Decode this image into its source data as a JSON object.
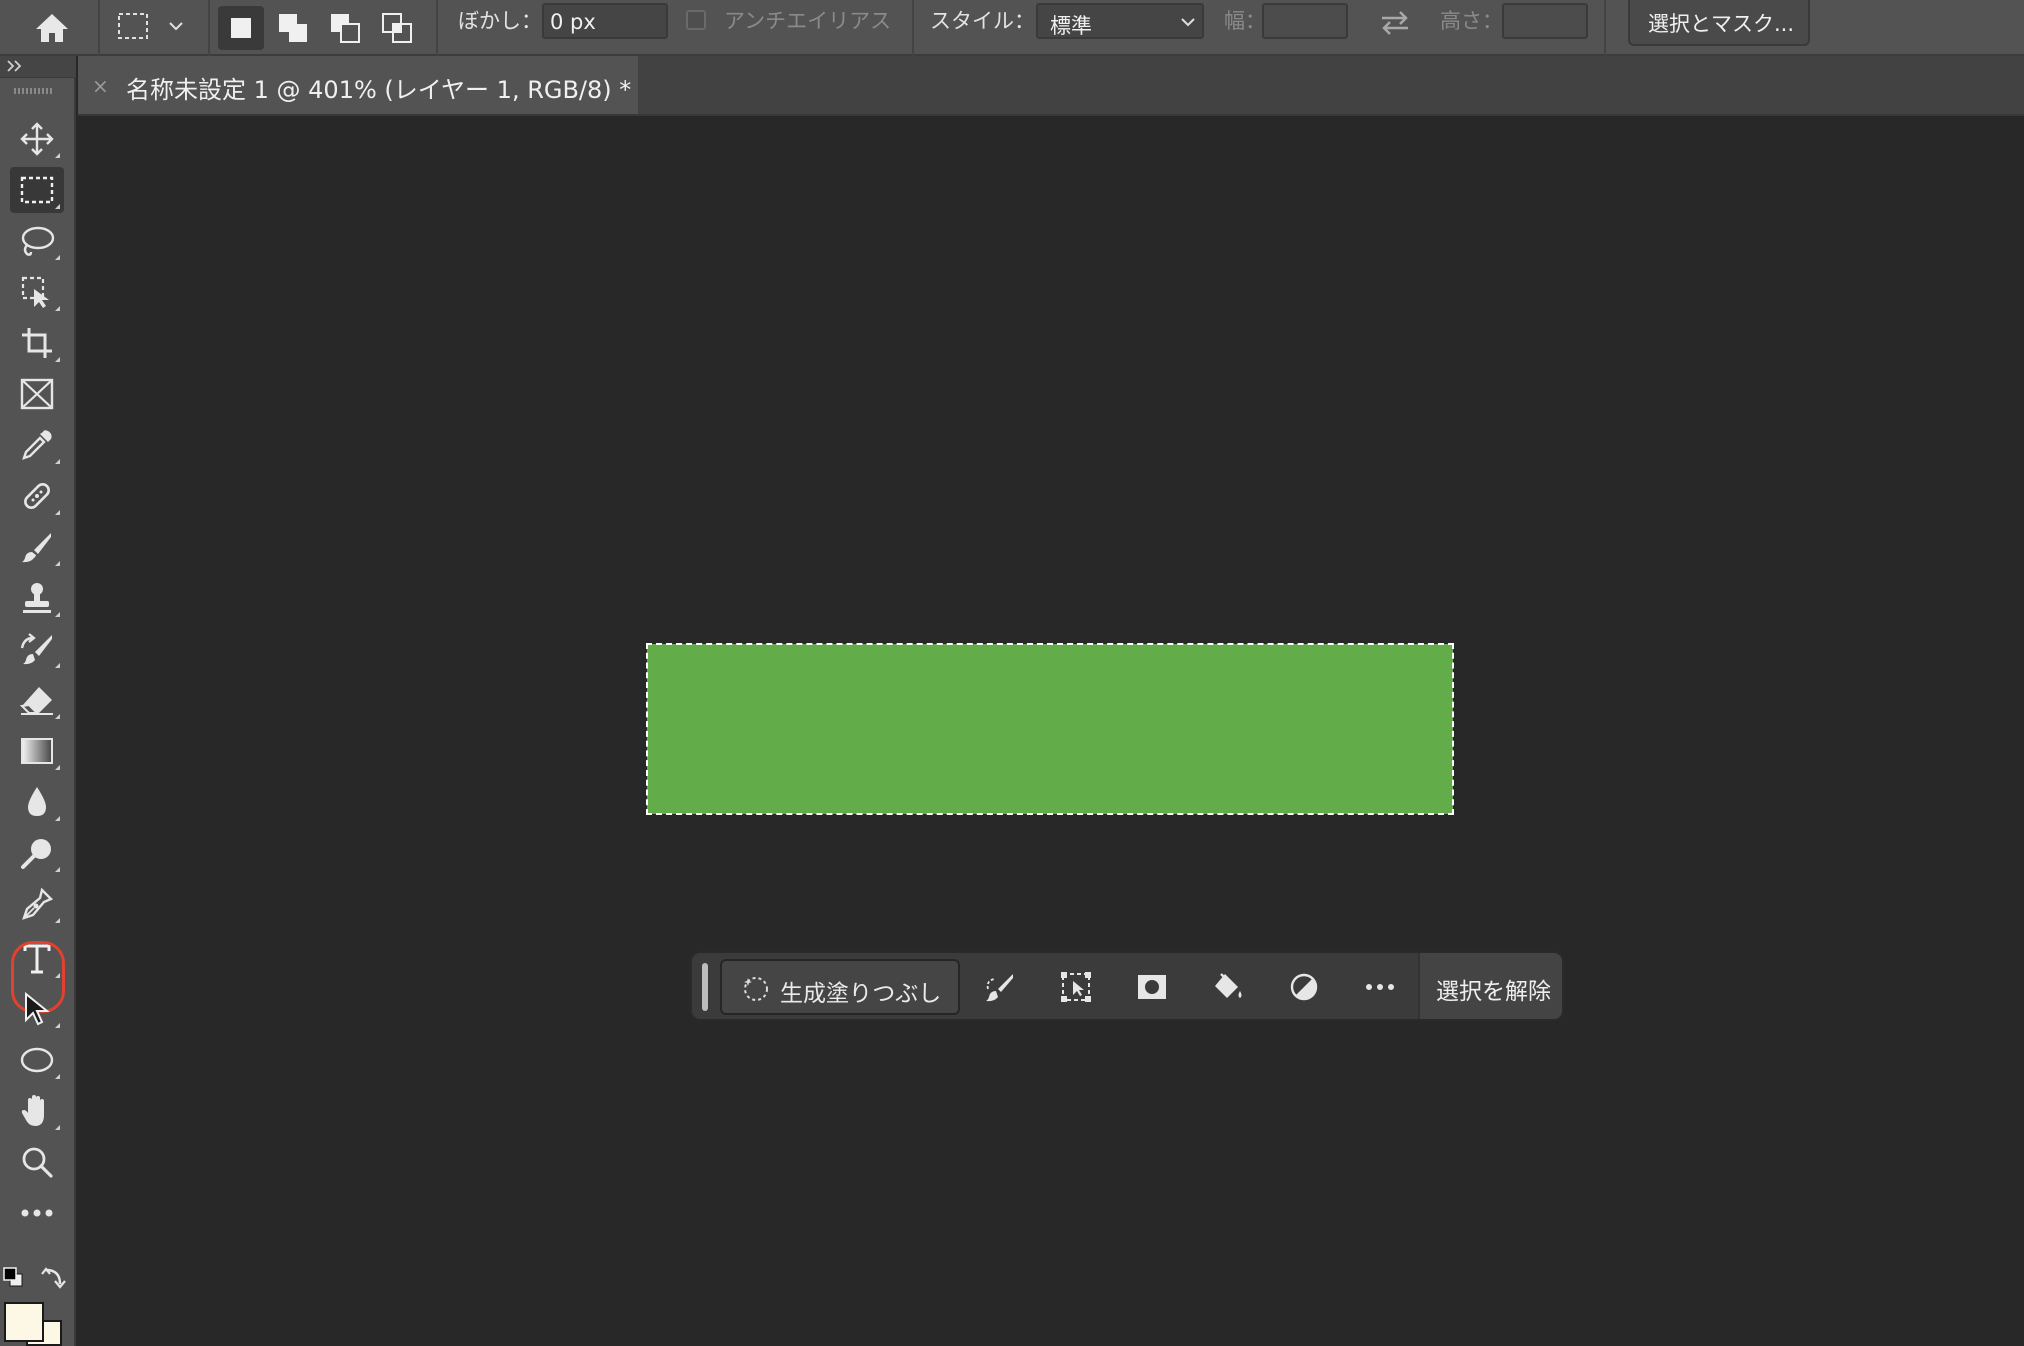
{
  "options_bar": {
    "feather_label": "ぼかし：",
    "feather_value": "0 px",
    "antialias_label": "アンチエイリアス",
    "style_label": "スタイル：",
    "style_value": "標準",
    "width_label": "幅：",
    "height_label": "高さ：",
    "select_mask_button": "選択とマスク..."
  },
  "document_tab": {
    "title": "名称未設定 1 @ 401% (レイヤー 1, RGB/8) *",
    "close_glyph": "×"
  },
  "task_bar": {
    "generative_fill_label": "生成塗りつぶし",
    "deselect_label": "選択を解除"
  },
  "colors": {
    "canvas_bg": "#282828",
    "panel_bg": "#535353",
    "selection_fill": "#62ad4a",
    "highlight_ring": "#e0422e",
    "foreground_swatch": "#000000",
    "background_swatch": "#fdf8e6"
  },
  "tools": [
    "move-tool",
    "rectangular-marquee-tool",
    "lasso-tool",
    "object-selection-tool",
    "crop-tool",
    "frame-tool",
    "eyedropper-tool",
    "spot-healing-tool",
    "brush-tool",
    "clone-stamp-tool",
    "history-brush-tool",
    "eraser-tool",
    "gradient-tool",
    "blur-tool",
    "dodge-tool",
    "pen-tool",
    "type-tool",
    "path-selection-tool",
    "ellipse-tool",
    "hand-tool",
    "zoom-tool",
    "edit-toolbar"
  ],
  "active_tool": "rectangular-marquee-tool",
  "highlighted_tool": "type-tool"
}
